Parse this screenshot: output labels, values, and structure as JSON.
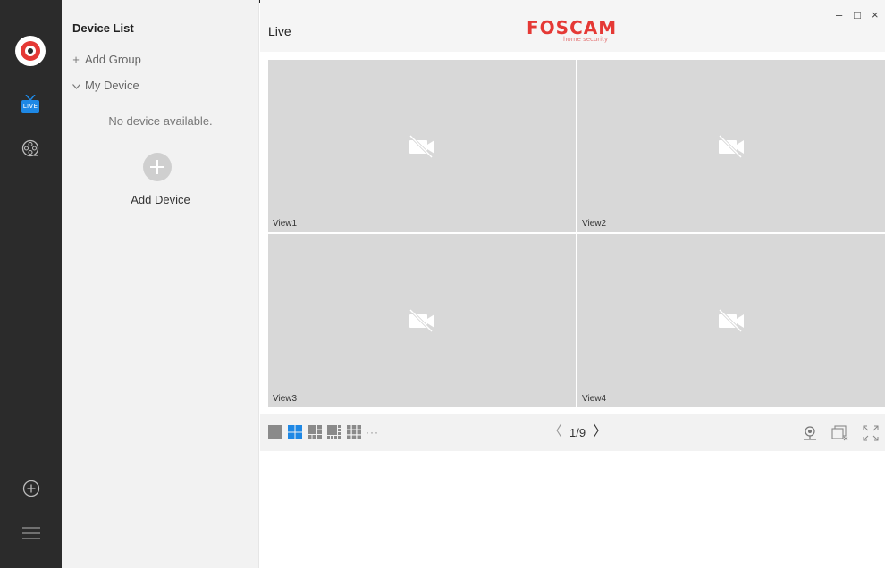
{
  "sidebar": {
    "live_badge": "LIVE"
  },
  "device_list": {
    "title": "Device List",
    "add_group": "Add Group",
    "my_device": "My Device",
    "empty_text": "No device available.",
    "add_device": "Add Device"
  },
  "header": {
    "page_title": "Live",
    "brand": "FOSCAM",
    "brand_sub": "home security",
    "minimize": "–",
    "maximize": "□",
    "close": "×"
  },
  "views": [
    {
      "label": "View1"
    },
    {
      "label": "View2"
    },
    {
      "label": "View3"
    },
    {
      "label": "View4"
    }
  ],
  "controls": {
    "more_layouts": "···",
    "page": "1/9",
    "prev": "〈",
    "next": "〉",
    "active_layout": "4-split"
  },
  "colors": {
    "accent": "#1e88e5",
    "brand": "#e53935",
    "rail": "#2b2b2b",
    "view_bg": "#d8d8d8"
  },
  "icons": [
    "foscam-logo-icon",
    "live-tv-icon",
    "film-reel-icon",
    "add-circle-icon",
    "menu-icon",
    "camera-off-icon",
    "ptz-camera-icon",
    "close-all-views-icon",
    "fullscreen-icon"
  ]
}
